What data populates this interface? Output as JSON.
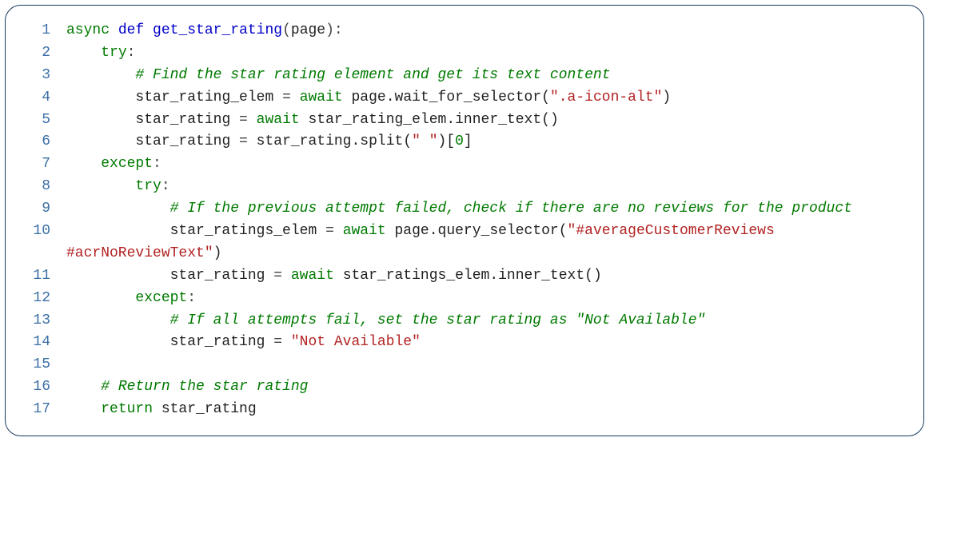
{
  "language": "python",
  "lines": [
    {
      "n": "1",
      "tokens": [
        {
          "cls": "kw-async",
          "t": "async"
        },
        {
          "cls": "nm",
          "t": " "
        },
        {
          "cls": "kw-def",
          "t": "def"
        },
        {
          "cls": "nm",
          "t": " "
        },
        {
          "cls": "fn-name",
          "t": "get_star_rating"
        },
        {
          "cls": "punct",
          "t": "("
        },
        {
          "cls": "nm",
          "t": "page"
        },
        {
          "cls": "punct",
          "t": "):"
        }
      ]
    },
    {
      "n": "2",
      "tokens": [
        {
          "cls": "nm",
          "t": "    "
        },
        {
          "cls": "kw-try",
          "t": "try"
        },
        {
          "cls": "punct",
          "t": ":"
        }
      ]
    },
    {
      "n": "3",
      "tokens": [
        {
          "cls": "nm",
          "t": "        "
        },
        {
          "cls": "comment",
          "t": "# Find the star rating element and get its text content"
        }
      ]
    },
    {
      "n": "4",
      "tokens": [
        {
          "cls": "nm",
          "t": "        star_rating_elem "
        },
        {
          "cls": "punct",
          "t": "="
        },
        {
          "cls": "nm",
          "t": " "
        },
        {
          "cls": "kw-await",
          "t": "await"
        },
        {
          "cls": "nm",
          "t": " page.wait_for_selector("
        },
        {
          "cls": "string",
          "t": "\".a-icon-alt\""
        },
        {
          "cls": "nm",
          "t": ")"
        }
      ]
    },
    {
      "n": "5",
      "tokens": [
        {
          "cls": "nm",
          "t": "        star_rating "
        },
        {
          "cls": "punct",
          "t": "="
        },
        {
          "cls": "nm",
          "t": " "
        },
        {
          "cls": "kw-await",
          "t": "await"
        },
        {
          "cls": "nm",
          "t": " star_rating_elem.inner_text()"
        }
      ]
    },
    {
      "n": "6",
      "tokens": [
        {
          "cls": "nm",
          "t": "        star_rating "
        },
        {
          "cls": "punct",
          "t": "="
        },
        {
          "cls": "nm",
          "t": " star_rating.split("
        },
        {
          "cls": "string",
          "t": "\" \""
        },
        {
          "cls": "nm",
          "t": ")["
        },
        {
          "cls": "num",
          "t": "0"
        },
        {
          "cls": "nm",
          "t": "]"
        }
      ]
    },
    {
      "n": "7",
      "tokens": [
        {
          "cls": "nm",
          "t": "    "
        },
        {
          "cls": "kw-except",
          "t": "except"
        },
        {
          "cls": "punct",
          "t": ":"
        }
      ]
    },
    {
      "n": "8",
      "tokens": [
        {
          "cls": "nm",
          "t": "        "
        },
        {
          "cls": "kw-try",
          "t": "try"
        },
        {
          "cls": "punct",
          "t": ":"
        }
      ]
    },
    {
      "n": "9",
      "tokens": [
        {
          "cls": "nm",
          "t": "            "
        },
        {
          "cls": "comment",
          "t": "# If the previous attempt failed, check if there are no reviews for the product"
        }
      ]
    },
    {
      "n": "10",
      "tokens": [
        {
          "cls": "nm",
          "t": "            star_ratings_elem "
        },
        {
          "cls": "punct",
          "t": "="
        },
        {
          "cls": "nm",
          "t": " "
        },
        {
          "cls": "kw-await",
          "t": "await"
        },
        {
          "cls": "nm",
          "t": " page.query_selector("
        },
        {
          "cls": "string",
          "t": "\"#averageCustomerReviews #acrNoReviewText\""
        },
        {
          "cls": "nm",
          "t": ")"
        }
      ]
    },
    {
      "n": "11",
      "tokens": [
        {
          "cls": "nm",
          "t": "            star_rating "
        },
        {
          "cls": "punct",
          "t": "="
        },
        {
          "cls": "nm",
          "t": " "
        },
        {
          "cls": "kw-await",
          "t": "await"
        },
        {
          "cls": "nm",
          "t": " star_ratings_elem.inner_text()"
        }
      ]
    },
    {
      "n": "12",
      "tokens": [
        {
          "cls": "nm",
          "t": "        "
        },
        {
          "cls": "kw-except",
          "t": "except"
        },
        {
          "cls": "punct",
          "t": ":"
        }
      ]
    },
    {
      "n": "13",
      "tokens": [
        {
          "cls": "nm",
          "t": "            "
        },
        {
          "cls": "comment",
          "t": "# If all attempts fail, set the star rating as \"Not Available\""
        }
      ]
    },
    {
      "n": "14",
      "tokens": [
        {
          "cls": "nm",
          "t": "            star_rating "
        },
        {
          "cls": "punct",
          "t": "="
        },
        {
          "cls": "nm",
          "t": " "
        },
        {
          "cls": "string",
          "t": "\"Not Available\""
        }
      ]
    },
    {
      "n": "15",
      "tokens": [
        {
          "cls": "nm",
          "t": ""
        }
      ]
    },
    {
      "n": "16",
      "tokens": [
        {
          "cls": "nm",
          "t": "    "
        },
        {
          "cls": "comment",
          "t": "# Return the star rating"
        }
      ]
    },
    {
      "n": "17",
      "tokens": [
        {
          "cls": "nm",
          "t": "    "
        },
        {
          "cls": "kw-return",
          "t": "return"
        },
        {
          "cls": "nm",
          "t": " star_rating"
        }
      ]
    }
  ]
}
